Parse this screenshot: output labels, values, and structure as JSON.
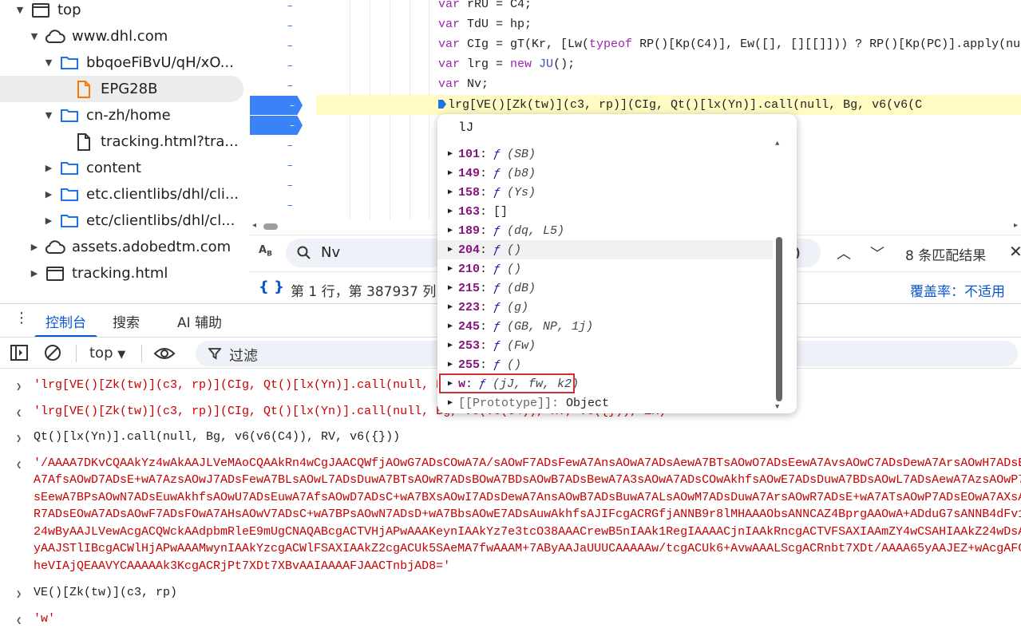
{
  "tree": {
    "items": [
      {
        "label": "top",
        "level": 0,
        "twisty": "open",
        "icon": "window-icon"
      },
      {
        "label": "www.dhl.com",
        "level": 1,
        "twisty": "open",
        "icon": "cloud-icon"
      },
      {
        "label": "bbqoeFiBvU/qH/xO...",
        "level": 2,
        "twisty": "open",
        "icon": "folder-icon"
      },
      {
        "label": "EPG28B",
        "level": 3,
        "twisty": "none",
        "icon": "js-file-icon",
        "selected": true
      },
      {
        "label": "cn-zh/home",
        "level": 2,
        "twisty": "open",
        "icon": "folder-icon"
      },
      {
        "label": "tracking.html?tra...",
        "level": 3,
        "twisty": "none",
        "icon": "file-icon"
      },
      {
        "label": "content",
        "level": 2,
        "twisty": "closed",
        "icon": "folder-icon"
      },
      {
        "label": "etc.clientlibs/dhl/cli...",
        "level": 2,
        "twisty": "closed",
        "icon": "folder-icon"
      },
      {
        "label": "etc/clientlibs/dhl/cl...",
        "level": 2,
        "twisty": "closed",
        "icon": "folder-icon"
      },
      {
        "label": "assets.adobedtm.com",
        "level": 1,
        "twisty": "closed",
        "icon": "cloud-icon"
      },
      {
        "label": "tracking.html",
        "level": 1,
        "twisty": "closed",
        "icon": "window-icon"
      }
    ]
  },
  "editor": {
    "gutter_marks": [
      "–",
      "–",
      "–",
      "–",
      "–",
      "–",
      "–",
      "–",
      "–",
      "–",
      "–"
    ],
    "breakpoint_labels": [
      "–",
      "–"
    ],
    "lines": [
      {
        "tokens": [
          [
            "kw",
            "var "
          ],
          [
            "nm",
            "rRU = C4;"
          ]
        ]
      },
      {
        "tokens": [
          [
            "kw",
            "var "
          ],
          [
            "nm",
            "TdU = hp;"
          ]
        ]
      },
      {
        "tokens": [
          [
            "kw",
            "var "
          ],
          [
            "nm",
            "CIg = gT(Kr, [Lw("
          ],
          [
            "kw",
            "typeof "
          ],
          [
            "nm",
            "RP()[Kp(C4)], Ew([], [][[]])) ? RP()[Kp(PC)].apply(nu"
          ]
        ]
      },
      {
        "tokens": [
          [
            "kw",
            "var "
          ],
          [
            "nm",
            "lrg = "
          ],
          [
            "kw",
            "new "
          ],
          [
            "fn",
            "JU"
          ],
          [
            "nm",
            "();"
          ]
        ]
      },
      {
        "tokens": [
          [
            "kw",
            "var "
          ],
          [
            "nm",
            "Nv;"
          ]
        ]
      }
    ],
    "current_line": "lrg[VE()[Zk(tw)](c3, rp)](CIg, Qt()[lx(Yn)].call(null, Bg, v6(v6(C"
  },
  "search": {
    "value": "Nv",
    "regex_hint": "*)",
    "match_count": "8 条匹配结果"
  },
  "status": {
    "position": "第 1 行，第 387937 列",
    "coverage": "覆盖率：不适用"
  },
  "drawer_tabs": [
    "控制台",
    "搜索",
    "AI 辅助"
  ],
  "console_toolbar": {
    "context": "top",
    "filter_placeholder": "过滤"
  },
  "console": [
    {
      "type": "input",
      "text": "'lrg[VE()[Zk(tw)](c3, rp)](CIg, Qt()[lx(Yn)].call(null, Bg, v6(v6(C4)), RV, v6({})), ZK)'"
    },
    {
      "type": "output",
      "text": "'lrg[VE()[Zk(tw)](c3, rp)](CIg, Qt()[lx(Yn)].call(null, Bg, v6(v6(C4)), RV, v6({})), ZK)'"
    },
    {
      "type": "input",
      "text": "Qt()[lx(Yn)].call(null, Bg, v6(v6(C4)), RV, v6({}))"
    },
    {
      "type": "output",
      "lines": [
        "'/AAAA7DKvCQAAkYz4wAkAAJLVeMAoCQAAkRn4wCgJAACQWfjAOwG7ADsCOwA7A/sAOwF7ADsFewA7AnsAOwA7ADsAewA7BTsAOwO7ADsEewA7AvsAOwC7ADsDewA7ArsAOwH7ADsE",
        "A7AfsAOwD7ADsE+wA7AzsAOwJ7ADsFewA7BLsAOwL7ADsDuwA7BTsAOwR7ADsBOwA7BDsAOwB7ADsBewA7A3sAOwA7ADsCOwAkhfsAOwE7ADsDuwA7BDsAOwL7ADsAewA7AzsAOwP7",
        "sEewA7BPsAOwN7ADsEuwAkhfsAOwU7ADsEuwA7AfsAOwD7ADsC+wA7BXsAOwI7ADsDewA7AnsAOwB7ADsBuwA7ALsAOwM7ADsDuwA7ArsAOwR7ADsE+wA7ATsAOwP7ADsEOwA7AXsA",
        "R7ADsEOwA7ADsAOwF7ADsFOwA7AHsAOwV7ADsC+wA7BPsAOwN7ADsD+wA7BbsAOwE7ADsAuwAkhfsAJIFcgACRGfjANNB9r8lMHAAAObsANNCAZ4BprgAAOwA+ADduG7sANNB4dFv1",
        "24wByAAJLVewAcgACQWckAAdpbmRleE9mUgCNAQABcgACTVHjAPwAAAKeynIAAkYz7e3tcO38AAACrewB5nIAAk1RegIAAAACjnIAAkRncgACTVFSAXIAAmZY4wCSAHIAAkZ24wDsA",
        "yAAJSTlIBcgACWlHjAPwAAAMwynIAAkYzcgACWlFSAXIAAkZ2cgACUk5SAeMA7fwAAAM+7AByAAJaUUUCAAAAAw/tcgACUk6+AvwAAALScgACRnbt7XDt/AAAA65yAAJEZ+wAcgAFG",
        "heVIAjQEAAVYCAAAAAk3KcgACRjPt7XDt7XBvAAIAAAAFJAACTnbjAD8='"
      ]
    },
    {
      "type": "input",
      "text": "VE()[Zk(tw)](c3, rp)"
    },
    {
      "type": "output",
      "text": "'w'"
    }
  ],
  "autocomplete": {
    "header": "lJ",
    "items": [
      {
        "key": "101",
        "f": "ƒ",
        "sig": "(SB)"
      },
      {
        "key": "149",
        "f": "ƒ",
        "sig": "(b8)"
      },
      {
        "key": "158",
        "f": "ƒ",
        "sig": "(Ys)"
      },
      {
        "key": "163",
        "f": "",
        "sig": "[]"
      },
      {
        "key": "189",
        "f": "ƒ",
        "sig": "(dq, L5)"
      },
      {
        "key": "204",
        "f": "ƒ",
        "sig": "()",
        "hover": true
      },
      {
        "key": "210",
        "f": "ƒ",
        "sig": "()"
      },
      {
        "key": "215",
        "f": "ƒ",
        "sig": "(dB)"
      },
      {
        "key": "223",
        "f": "ƒ",
        "sig": "(g)"
      },
      {
        "key": "245",
        "f": "ƒ",
        "sig": "(GB, NP, 1j)"
      },
      {
        "key": "253",
        "f": "ƒ",
        "sig": "(Fw)"
      },
      {
        "key": "255",
        "f": "ƒ",
        "sig": "()"
      },
      {
        "key": "w",
        "f": "ƒ",
        "sig": "(jJ, fw, k2)",
        "highlighted": true
      },
      {
        "key": "[[Prototype]]",
        "f": "",
        "sig": "Object",
        "proto": true
      }
    ]
  },
  "colors": {
    "accent": "#0b57d0",
    "string": "#c80000",
    "keyword": "#9b27b0",
    "highlight_line": "#fffbc2",
    "annotation_box": "#d32f2f"
  }
}
